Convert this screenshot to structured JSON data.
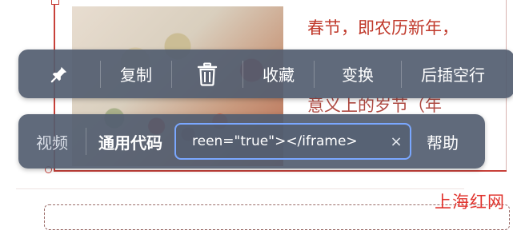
{
  "article": {
    "line1": "春节，即农历新年，",
    "line3": "意义上的岁节（年",
    "watermark": "上海红网"
  },
  "toolbar_main": {
    "pin_icon": "pin-icon",
    "copy_label": "复制",
    "delete_icon": "trash-icon",
    "favorite_label": "收藏",
    "convert_label": "变换",
    "insert_after_label": "后插空行"
  },
  "toolbar_embed": {
    "video_tab": "视频",
    "code_tab": "通用代码",
    "code_value": "reen=\"true\"></iframe>",
    "clear_icon": "×",
    "help_label": "帮助"
  },
  "colors": {
    "toolbar_bg": "#525d70",
    "input_focus_border": "#7aa7ff",
    "article_text": "#c0392b",
    "watermark": "#e0302a"
  }
}
